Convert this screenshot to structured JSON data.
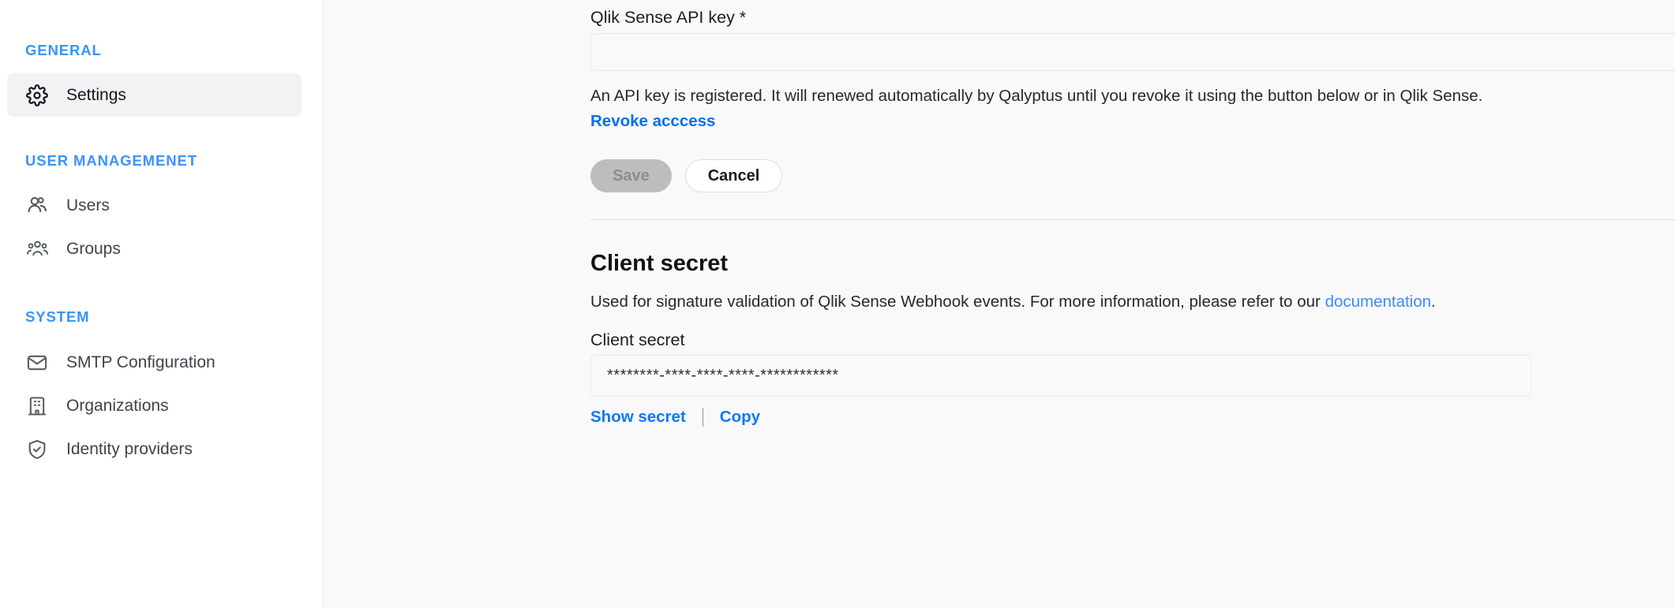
{
  "sidebar": {
    "sections": [
      {
        "label": "GENERAL",
        "items": [
          {
            "label": "Settings",
            "icon": "gear-icon",
            "active": true
          }
        ]
      },
      {
        "label": "USER MANAGEMENET",
        "items": [
          {
            "label": "Users",
            "icon": "users-icon",
            "active": false
          },
          {
            "label": "Groups",
            "icon": "group-icon",
            "active": false
          }
        ]
      },
      {
        "label": "SYSTEM",
        "items": [
          {
            "label": "SMTP Configuration",
            "icon": "envelope-icon",
            "active": false
          },
          {
            "label": "Organizations",
            "icon": "building-icon",
            "active": false
          },
          {
            "label": "Identity providers",
            "icon": "shield-check-icon",
            "active": false
          }
        ]
      }
    ]
  },
  "main": {
    "api_key": {
      "label": "Qlik Sense API key *",
      "value": "",
      "placeholder": "",
      "help_text": "An API key is registered. It will renewed automatically by Qalyptus until you revoke it using the button below or in Qlik Sense.",
      "revoke_link": "Revoke acccess",
      "save_label": "Save",
      "cancel_label": "Cancel"
    },
    "client_secret": {
      "title": "Client secret",
      "description_before": "Used for signature validation of Qlik Sense Webhook events. For more information, please refer to our ",
      "description_link": "documentation",
      "description_after": ".",
      "field_label": "Client secret",
      "value": "********-****-****-****-************",
      "show_secret_label": "Show secret",
      "copy_label": "Copy"
    }
  },
  "colors": {
    "accent_blue": "#3b93f7",
    "link_blue": "#1178f2",
    "page_bg": "#f9f9fa",
    "sidebar_bg": "#ffffff"
  }
}
